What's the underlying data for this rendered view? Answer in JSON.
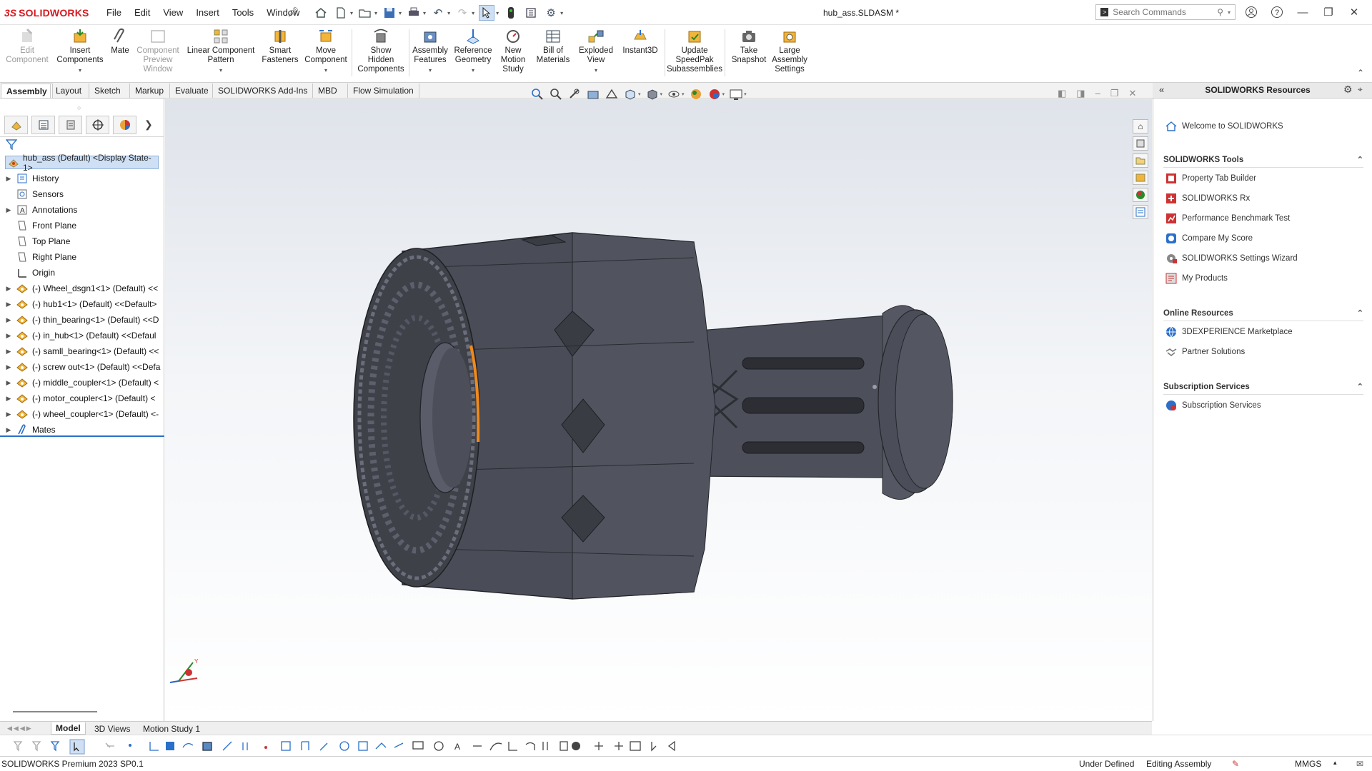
{
  "app": {
    "brand_prefix": "3S",
    "brand": "SOLIDWORKS",
    "document_title": "hub_ass.SLDASM *"
  },
  "menu": [
    "File",
    "Edit",
    "View",
    "Insert",
    "Tools",
    "Window"
  ],
  "search": {
    "placeholder": "Search Commands"
  },
  "commands": [
    {
      "label": "Edit\nComponent",
      "enabled": false
    },
    {
      "label": "Insert\nComponents",
      "enabled": true
    },
    {
      "label": "Mate",
      "enabled": true
    },
    {
      "label": "Component\nPreview\nWindow",
      "enabled": false
    },
    {
      "label": "Linear Component\nPattern",
      "enabled": true
    },
    {
      "label": "Smart\nFasteners",
      "enabled": true
    },
    {
      "label": "Move\nComponent",
      "enabled": true
    },
    {
      "label": "Show\nHidden\nComponents",
      "enabled": true
    },
    {
      "label": "Assembly\nFeatures",
      "enabled": true
    },
    {
      "label": "Reference\nGeometry",
      "enabled": true
    },
    {
      "label": "New\nMotion\nStudy",
      "enabled": true
    },
    {
      "label": "Bill of\nMaterials",
      "enabled": true
    },
    {
      "label": "Exploded\nView",
      "enabled": true
    },
    {
      "label": "Instant3D",
      "enabled": true
    },
    {
      "label": "Update\nSpeedPak\nSubassemblies",
      "enabled": true
    },
    {
      "label": "Take\nSnapshot",
      "enabled": true
    },
    {
      "label": "Large\nAssembly\nSettings",
      "enabled": true
    }
  ],
  "tabs": [
    "Assembly",
    "Layout",
    "Sketch",
    "Markup",
    "Evaluate",
    "SOLIDWORKS Add-Ins",
    "MBD",
    "Flow Simulation"
  ],
  "active_tab": "Assembly",
  "tree": {
    "root": "hub_ass (Default) <Display State-1>",
    "items": [
      {
        "label": "History",
        "expandable": true,
        "icon": "history-icon"
      },
      {
        "label": "Sensors",
        "expandable": false,
        "icon": "sensors-icon"
      },
      {
        "label": "Annotations",
        "expandable": true,
        "icon": "annotations-icon"
      },
      {
        "label": "Front Plane",
        "expandable": false,
        "icon": "plane-icon"
      },
      {
        "label": "Top Plane",
        "expandable": false,
        "icon": "plane-icon"
      },
      {
        "label": "Right Plane",
        "expandable": false,
        "icon": "plane-icon"
      },
      {
        "label": "Origin",
        "expandable": false,
        "icon": "origin-icon"
      },
      {
        "label": "(-) Wheel_dsgn1<1> (Default) <<",
        "expandable": true,
        "icon": "part-icon"
      },
      {
        "label": "(-) hub1<1> (Default) <<Default>",
        "expandable": true,
        "icon": "part-icon"
      },
      {
        "label": "(-) thin_bearing<1> (Default) <<D",
        "expandable": true,
        "icon": "part-icon"
      },
      {
        "label": "(-) in_hub<1> (Default) <<Defaul",
        "expandable": true,
        "icon": "part-icon"
      },
      {
        "label": "(-) samll_bearing<1> (Default) <<",
        "expandable": true,
        "icon": "part-icon"
      },
      {
        "label": "(-) screw out<1> (Default) <<Defa",
        "expandable": true,
        "icon": "part-icon"
      },
      {
        "label": "(-) middle_coupler<1> (Default) <",
        "expandable": true,
        "icon": "part-icon"
      },
      {
        "label": "(-) motor_coupler<1> (Default) <",
        "expandable": true,
        "icon": "part-icon"
      },
      {
        "label": "(-) wheel_coupler<1> (Default) <-",
        "expandable": true,
        "icon": "part-icon"
      },
      {
        "label": "Mates",
        "expandable": true,
        "icon": "mates-icon"
      }
    ]
  },
  "task_pane": {
    "title": "SOLIDWORKS Resources",
    "welcome": "Welcome to SOLIDWORKS",
    "sections": [
      {
        "title": "SOLIDWORKS Tools",
        "items": [
          "Property Tab Builder",
          "SOLIDWORKS Rx",
          "Performance Benchmark Test",
          "Compare My Score",
          "SOLIDWORKS Settings Wizard",
          "My Products"
        ]
      },
      {
        "title": "Online Resources",
        "items": [
          "3DEXPERIENCE Marketplace",
          "Partner Solutions"
        ]
      },
      {
        "title": "Subscription Services",
        "items": [
          "Subscription Services"
        ]
      }
    ]
  },
  "bottom_tabs": [
    "Model",
    "3D Views",
    "Motion Study 1"
  ],
  "active_bottom_tab": "Model",
  "status": {
    "version": "SOLIDWORKS Premium 2023 SP0.1",
    "state": "Under Defined",
    "mode": "Editing Assembly",
    "units": "MMGS"
  },
  "colors": {
    "brand": "#d71920",
    "model": "#4a4d57",
    "selection": "#cfe0f5",
    "accent_edge": "#f08a1c"
  }
}
